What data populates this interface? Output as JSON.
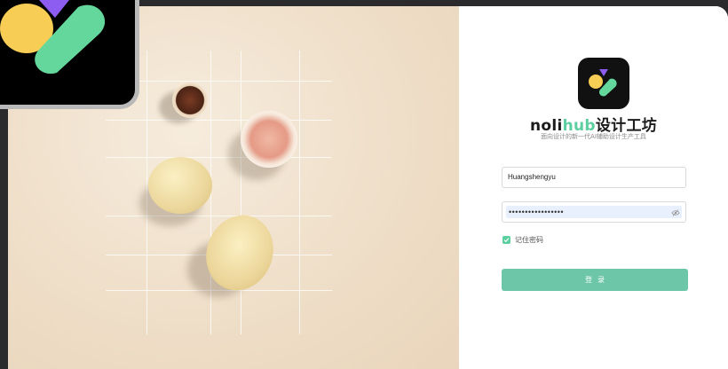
{
  "brand": {
    "name_part1": "noli",
    "name_part2": "hub",
    "name_suffix": "设计工坊",
    "tagline": "面向设计的新一代AI辅助设计生产工具"
  },
  "login": {
    "username_value": "Huangshengyu",
    "password_masked": "•••••••••••••••••",
    "remember_label": "记住密码",
    "remember_checked": true,
    "submit_label": "登录"
  },
  "colors": {
    "accent": "#5ccfa0",
    "button": "#6cc6a7",
    "logo_yellow": "#f7cd55",
    "logo_green": "#63d79c",
    "logo_purple": "#8d5cf0"
  },
  "icons": {
    "app_logo": "nolihub-logo-icon",
    "password_toggle": "eye-off-icon",
    "checkbox": "check-icon"
  }
}
